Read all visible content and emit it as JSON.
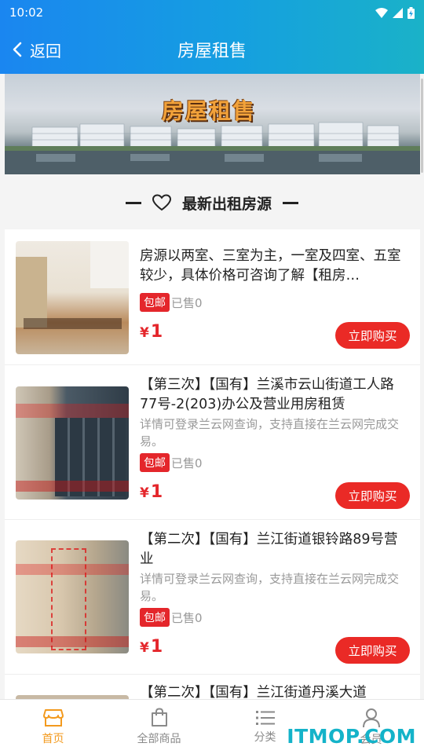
{
  "status": {
    "time": "10:02"
  },
  "header": {
    "back_label": "返回",
    "title": "房屋租售"
  },
  "banner": {
    "title": "房屋租售"
  },
  "section": {
    "title": "最新出租房源"
  },
  "products": [
    {
      "title": "房源以两室、三室为主，一室及四室、五室较少，具体价格可咨询了解【租房…",
      "desc": "",
      "tag": "包邮",
      "sold": "已售0",
      "currency": "¥",
      "price": "1",
      "buy_label": "立即购买"
    },
    {
      "title": "【第三次】【国有】兰溪市云山街道工人路77号-2(203)办公及营业用房租赁",
      "desc": "详情可登录兰云网查询，支持直接在兰云网完成交易。",
      "tag": "包邮",
      "sold": "已售0",
      "currency": "¥",
      "price": "1",
      "buy_label": "立即购买"
    },
    {
      "title": "【第二次】【国有】兰江街道银铃路89号营业",
      "desc": "详情可登录兰云网查询，支持直接在兰云网完成交易。",
      "tag": "包邮",
      "sold": "已售0",
      "currency": "¥",
      "price": "1",
      "buy_label": "立即购买"
    },
    {
      "title": "【第二次】【国有】兰江街道丹溪大道",
      "desc": "",
      "tag": "",
      "sold": "",
      "currency": "",
      "price": "",
      "buy_label": ""
    }
  ],
  "tabs": [
    {
      "label": "首页",
      "icon": "store-icon",
      "active": true
    },
    {
      "label": "全部商品",
      "icon": "bag-icon",
      "active": false
    },
    {
      "label": "分类",
      "icon": "list-icon",
      "active": false
    },
    {
      "label": "会员",
      "icon": "user-icon",
      "active": false
    }
  ],
  "watermark": "ITMOP.COM",
  "colors": {
    "header_start": "#1a86f0",
    "header_end": "#1ab2c8",
    "accent_red": "#e4262b",
    "tab_active": "#f39a1e"
  }
}
